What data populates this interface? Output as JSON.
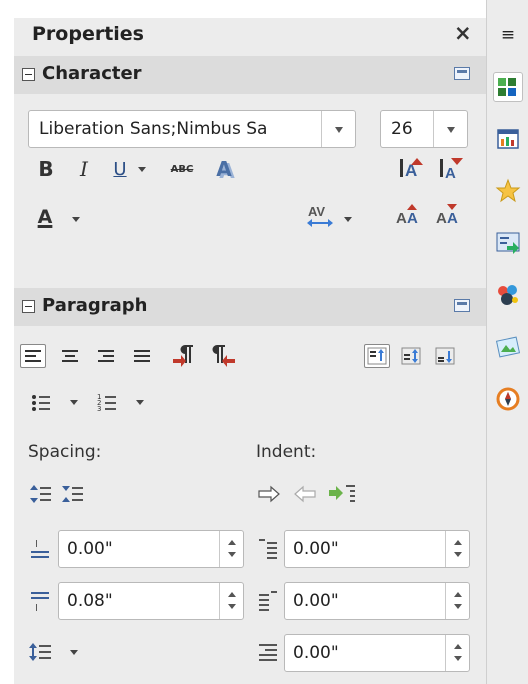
{
  "panel": {
    "title": "Properties",
    "close_glyph": "×"
  },
  "character": {
    "title": "Character",
    "font_name": "Liberation Sans;Nimbus Sa",
    "font_size": "26",
    "bold_label": "B",
    "italic_label": "I",
    "underline_label": "U",
    "strike_label": "ABC",
    "shadow_label": "A",
    "font_color_label": "A",
    "char_spacing_label": "AV"
  },
  "paragraph": {
    "title": "Paragraph",
    "spacing_label": "Spacing:",
    "indent_label": "Indent:",
    "above_spacing": "0.00\"",
    "below_spacing": "0.08\"",
    "before_indent": "0.00\"",
    "after_indent": "0.00\"",
    "first_line_indent": "0.00\""
  },
  "sidebar": {
    "menu_glyph": "≡",
    "items": [
      {
        "name": "properties-icon"
      },
      {
        "name": "styles-icon"
      },
      {
        "name": "gallery-icon"
      },
      {
        "name": "navigator-icon"
      },
      {
        "name": "functions-icon"
      },
      {
        "name": "media-icon"
      },
      {
        "name": "compass-icon"
      }
    ]
  },
  "colors": {
    "panel_bg": "#ececec",
    "header_bg": "#dcdcdc",
    "icon_blue": "#3a5f9a",
    "icon_red": "#c0392b"
  }
}
